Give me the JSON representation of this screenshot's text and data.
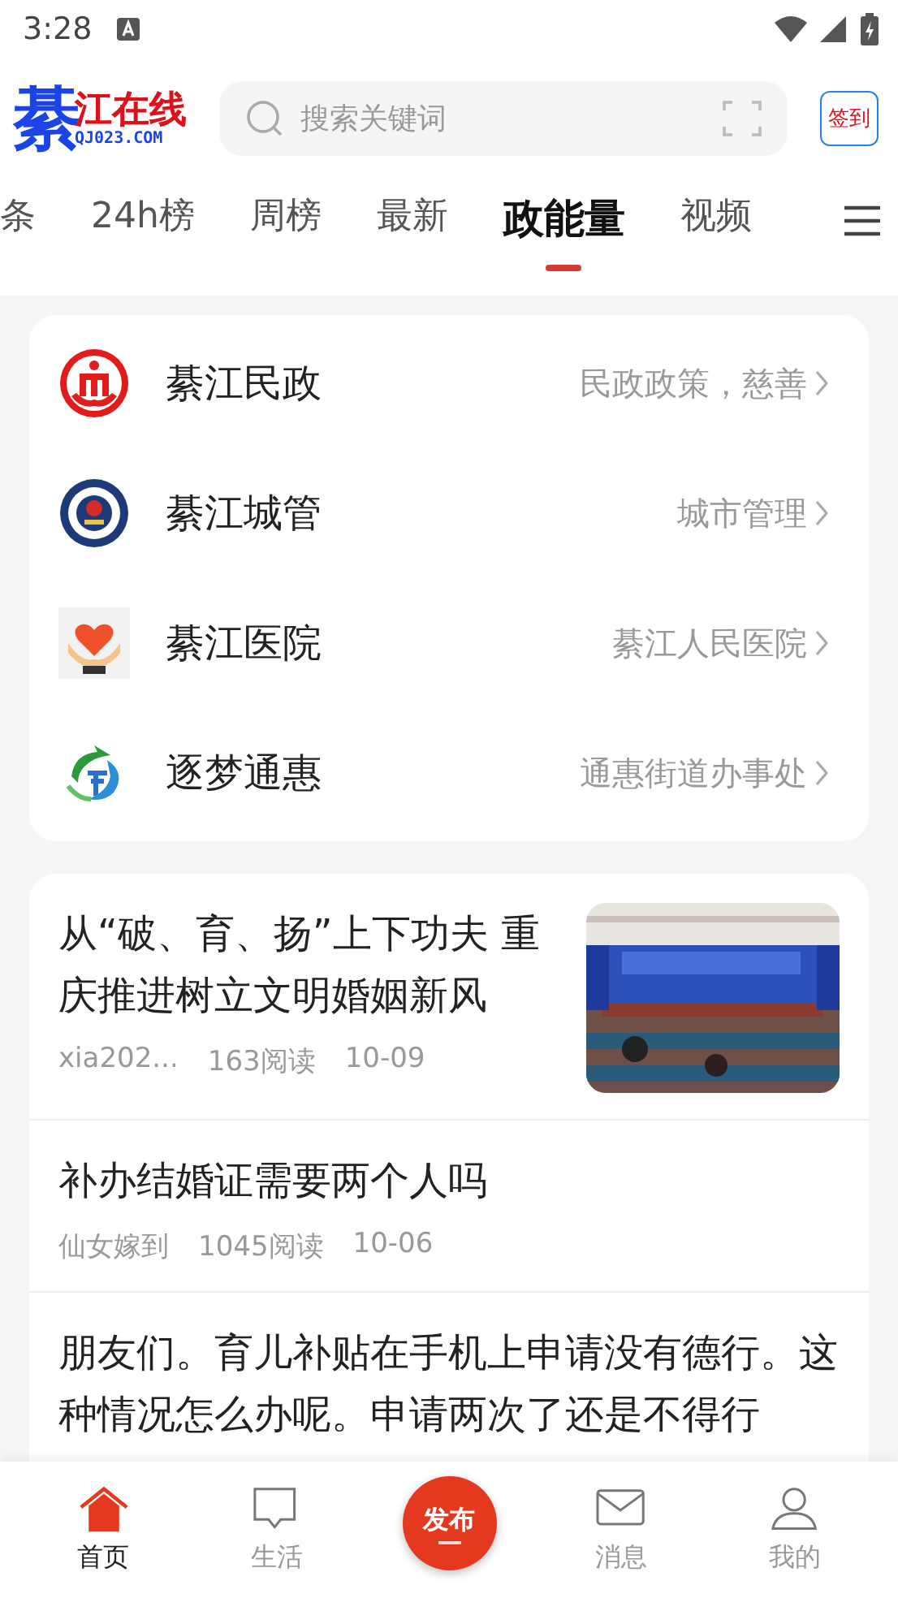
{
  "status_bar": {
    "time": "3:28"
  },
  "header": {
    "logo": {
      "mark": "綦",
      "name": "江在线",
      "domain": "QJ023.COM"
    },
    "search": {
      "placeholder": "搜索关键词"
    },
    "checkin_label": "签到"
  },
  "tabs": [
    {
      "label": "条",
      "selected": false
    },
    {
      "label": "24h榜",
      "selected": false
    },
    {
      "label": "周榜",
      "selected": false
    },
    {
      "label": "最新",
      "selected": false
    },
    {
      "label": "政能量",
      "selected": true
    },
    {
      "label": "视频",
      "selected": false
    }
  ],
  "services": [
    {
      "kind": "civil",
      "name": "綦江民政",
      "description": "民政政策，慈善"
    },
    {
      "kind": "city",
      "name": "綦江城管",
      "description": "城市管理"
    },
    {
      "kind": "hospital",
      "name": "綦江医院",
      "description": "綦江人民医院"
    },
    {
      "kind": "dream",
      "name": "逐梦通惠",
      "description": "通惠街道办事处"
    }
  ],
  "articles": [
    {
      "title": "从“破、育、扬”上下功夫 重庆推进树立文明婚姻新风",
      "author": "xia202...",
      "reads": "163阅读",
      "date": "10-09"
    },
    {
      "title": "补办结婚证需要两个人吗",
      "author": "仙女嫁到",
      "reads": "1045阅读",
      "date": "10-06"
    },
    {
      "title": "朋友们。育儿补贴在手机上申请没有德行。这种情况怎么办呢。申请两次了还是不得行"
    }
  ],
  "bottom_nav": [
    {
      "kind": "home",
      "label": "首页",
      "selected": true
    },
    {
      "kind": "life",
      "label": "生活",
      "selected": false
    },
    {
      "kind": "publish",
      "label": "发布",
      "selected": false
    },
    {
      "kind": "message",
      "label": "消息",
      "selected": false
    },
    {
      "kind": "profile",
      "label": "我的",
      "selected": false
    }
  ]
}
